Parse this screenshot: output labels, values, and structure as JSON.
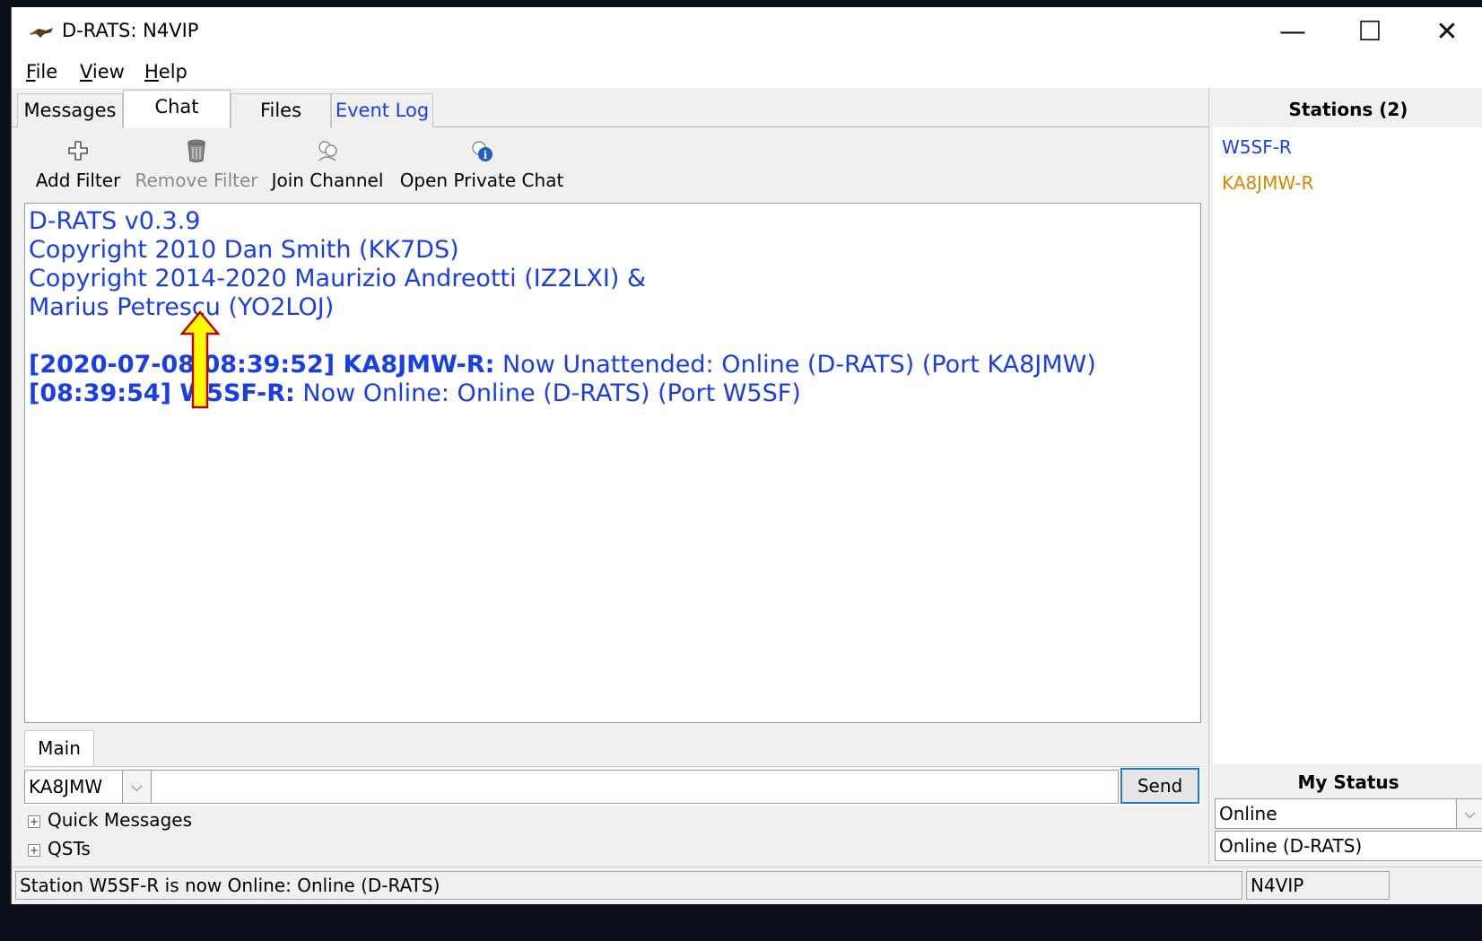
{
  "window": {
    "title": "D-RATS: N4VIP",
    "min_glyph": "—",
    "max_glyph": "☐",
    "close_glyph": "✕"
  },
  "menu": {
    "file": {
      "accel": "F",
      "rest": "ile"
    },
    "view": {
      "accel": "V",
      "rest": "iew"
    },
    "help": {
      "accel": "H",
      "rest": "elp"
    }
  },
  "tabs": {
    "messages": "Messages",
    "chat": "Chat",
    "files": "Files",
    "event_log": "Event Log"
  },
  "toolbar": {
    "add_filter": "Add Filter",
    "remove_filter": "Remove Filter",
    "join_channel": "Join Channel",
    "open_private_chat": "Open Private Chat"
  },
  "chat": {
    "banner": [
      "D-RATS v0.3.9",
      "Copyright 2010 Dan Smith (KK7DS)",
      "Copyright 2014-2020 Maurizio Andreotti (IZ2LXI) &",
      "Marius Petrescu (YO2LOJ)"
    ],
    "entries": [
      {
        "prefix": "[2020-07-08 08:39:52] KA8JMW-R:",
        "text": " Now Unattended: Online (D-RATS) (Port KA8JMW)"
      },
      {
        "prefix": "[08:39:54] W5SF-R:",
        "text": " Now Online: Online (D-RATS) (Port W5SF)"
      }
    ],
    "channel_tab": "Main",
    "callsign_selected": "KA8JMW",
    "message_value": "",
    "send_label": "Send",
    "quick_messages": "Quick Messages",
    "qsts": "QSTs"
  },
  "stations": {
    "header": "Stations (2)",
    "items": [
      "W5SF-R",
      "KA8JMW-R"
    ],
    "colors": [
      "#1a3ee6",
      "#d18a00"
    ]
  },
  "my_status": {
    "label": "My Status",
    "selected": "Online",
    "message": "Online (D-RATS)"
  },
  "statusbar": {
    "text": "Station W5SF-R is now Online: Online (D-RATS)",
    "callsign": "N4VIP"
  },
  "colors": {
    "chat_text": "#1a3ee6",
    "send_border": "#1e78d6",
    "annotation_arrow": "#ffff00"
  }
}
